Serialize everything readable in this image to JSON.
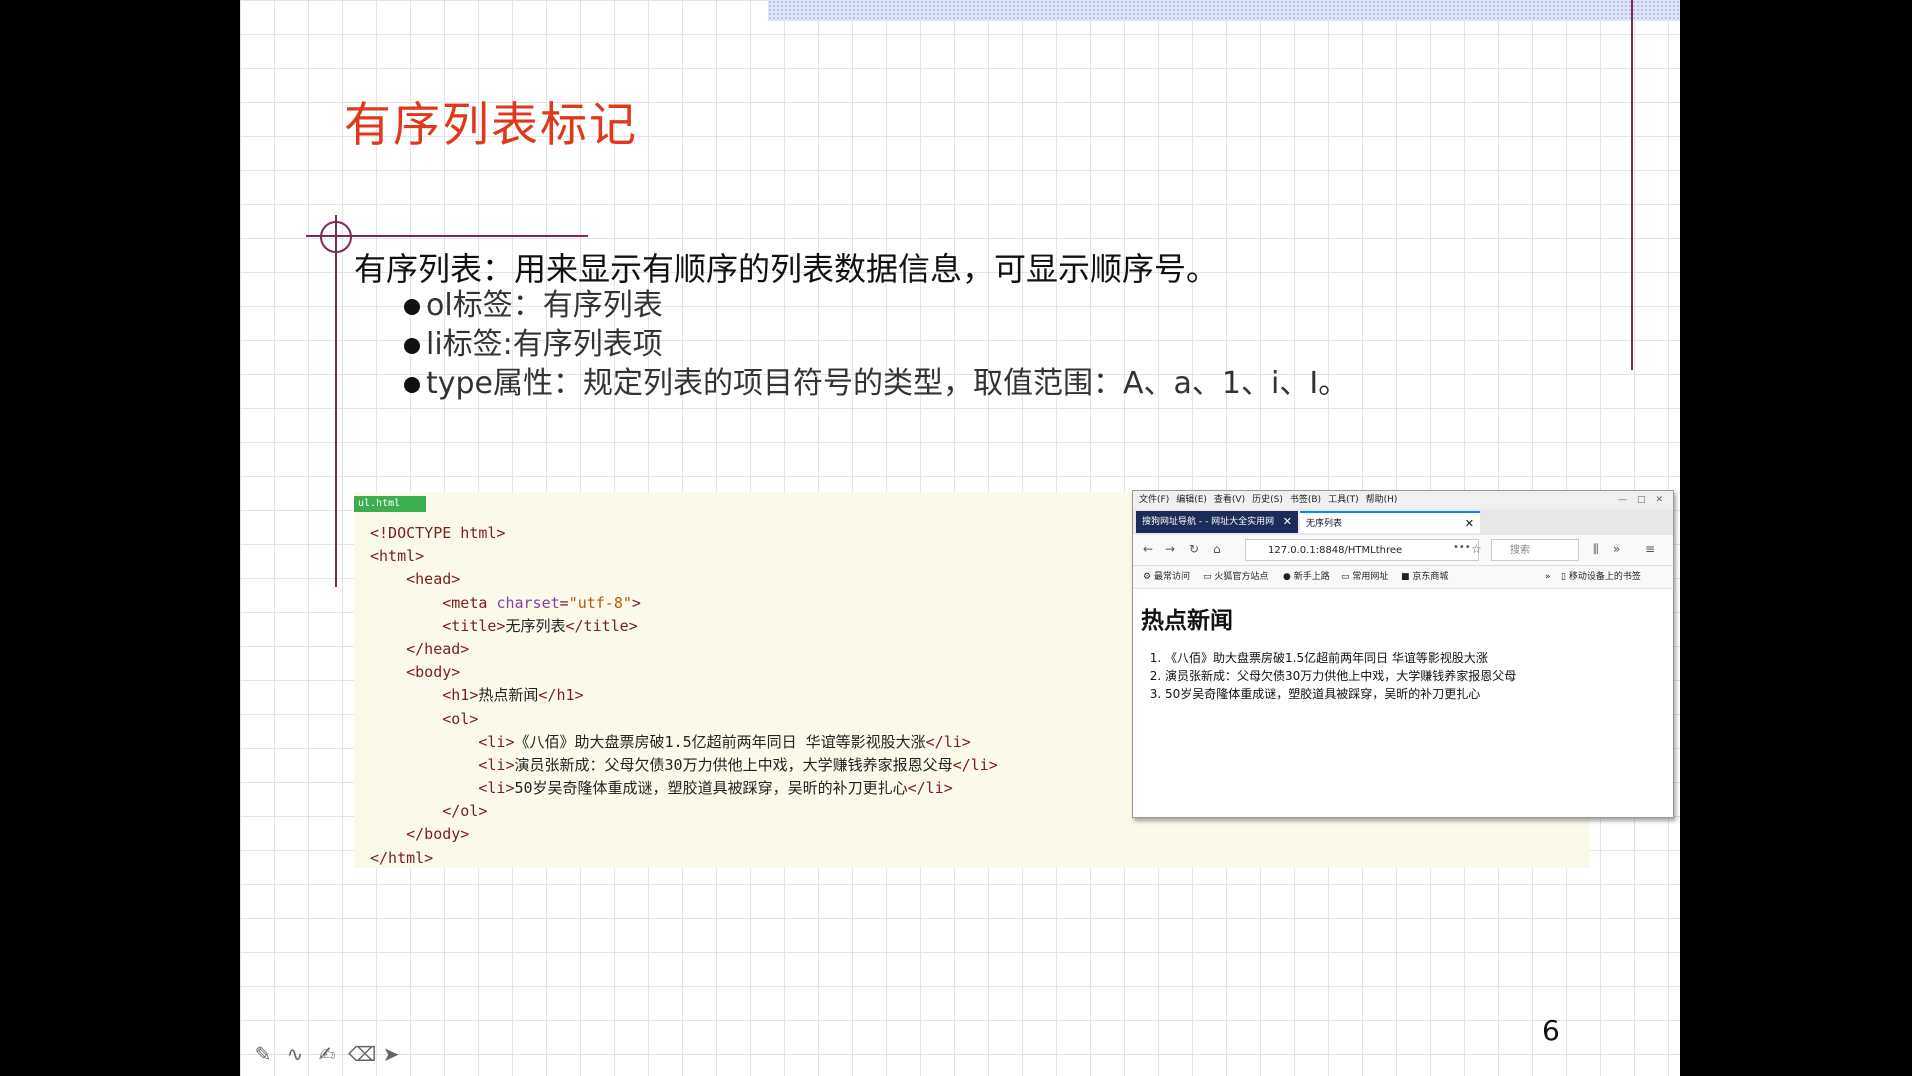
{
  "slide": {
    "title": "有序列表标记",
    "intro": "有序列表：用来显示有顺序的列表数据信息，可显示顺序号。",
    "bullets": [
      {
        "keyword": "ol",
        "text": "标签：有序列表"
      },
      {
        "keyword": "li",
        "text": "标签:有序列表项"
      },
      {
        "keyword": "type",
        "text": "属性：规定列表的项目符号的类型，取值范围：A、a、1、i、I。"
      }
    ],
    "page_number": "6"
  },
  "editor": {
    "file_tab": "ul.html",
    "lines": [
      {
        "indent": "",
        "parts": [
          [
            "tag",
            "<!DOCTYPE html>"
          ]
        ]
      },
      {
        "indent": "",
        "parts": [
          [
            "tag",
            "<html>"
          ]
        ]
      },
      {
        "indent": "    ",
        "parts": [
          [
            "tag",
            "<head>"
          ]
        ]
      },
      {
        "indent": "        ",
        "parts": [
          [
            "tag",
            "<meta "
          ],
          [
            "attr",
            "charset"
          ],
          [
            "tag",
            "="
          ],
          [
            "str",
            "\"utf-8\""
          ],
          [
            "tag",
            ">"
          ]
        ]
      },
      {
        "indent": "        ",
        "parts": [
          [
            "tag",
            "<title>"
          ],
          [
            "txt",
            "无序列表"
          ],
          [
            "tag",
            "</title>"
          ]
        ]
      },
      {
        "indent": "    ",
        "parts": [
          [
            "tag",
            "</head>"
          ]
        ]
      },
      {
        "indent": "    ",
        "parts": [
          [
            "tag",
            "<body>"
          ]
        ]
      },
      {
        "indent": "        ",
        "parts": [
          [
            "tag",
            "<h1>"
          ],
          [
            "txt",
            "热点新闻"
          ],
          [
            "tag",
            "</h1>"
          ]
        ]
      },
      {
        "indent": "        ",
        "parts": [
          [
            "tag",
            "<ol>"
          ]
        ]
      },
      {
        "indent": "            ",
        "parts": [
          [
            "tag",
            "<li>"
          ],
          [
            "txt",
            "《八佰》助大盘票房破1.5亿超前两年同日 华谊等影视股大涨"
          ],
          [
            "tag",
            "</li>"
          ]
        ]
      },
      {
        "indent": "            ",
        "parts": [
          [
            "tag",
            "<li>"
          ],
          [
            "txt",
            "演员张新成：父母欠债30万力供他上中戏，大学赚钱养家报恩父母"
          ],
          [
            "tag",
            "</li>"
          ]
        ]
      },
      {
        "indent": "            ",
        "parts": [
          [
            "tag",
            "<li>"
          ],
          [
            "txt",
            "50岁吴奇隆体重成谜，塑胶道具被踩穿，吴昕的补刀更扎心"
          ],
          [
            "tag",
            "</li>"
          ]
        ]
      },
      {
        "indent": "        ",
        "parts": [
          [
            "tag",
            "</ol>"
          ]
        ]
      },
      {
        "indent": "    ",
        "parts": [
          [
            "tag",
            "</body>"
          ]
        ]
      },
      {
        "indent": "",
        "parts": [
          [
            "tag",
            "</html>"
          ]
        ]
      }
    ]
  },
  "browser": {
    "menu": [
      "文件(F)",
      "编辑(E)",
      "查看(V)",
      "历史(S)",
      "书签(B)",
      "工具(T)",
      "帮助(H)"
    ],
    "window_buttons": [
      "—",
      "□",
      "✕"
    ],
    "tab1": "搜狗网址导航 - - 网址大全实用网",
    "tab2": "无序列表",
    "tab_close": "✕",
    "url": "127.0.0.1:8848/HTMLthree",
    "search_placeholder": "搜索",
    "bookmarks": [
      "最常访问",
      "火狐官方站点",
      "新手上路",
      "常用网址",
      "京东商城"
    ],
    "bookmarks_right": "移动设备上的书签",
    "page": {
      "heading": "热点新闻",
      "items": [
        "《八佰》助大盘票房破1.5亿超前两年同日 华谊等影视股大涨",
        "演员张新成：父母欠债30万力供他上中戏，大学赚钱养家报恩父母",
        "50岁吴奇隆体重成谜，塑胶道具被踩穿，吴昕的补刀更扎心"
      ]
    }
  },
  "toolbar_icons": [
    "pen-icon",
    "ink-icon",
    "highlighter-icon",
    "eraser-icon",
    "pointer-icon"
  ]
}
